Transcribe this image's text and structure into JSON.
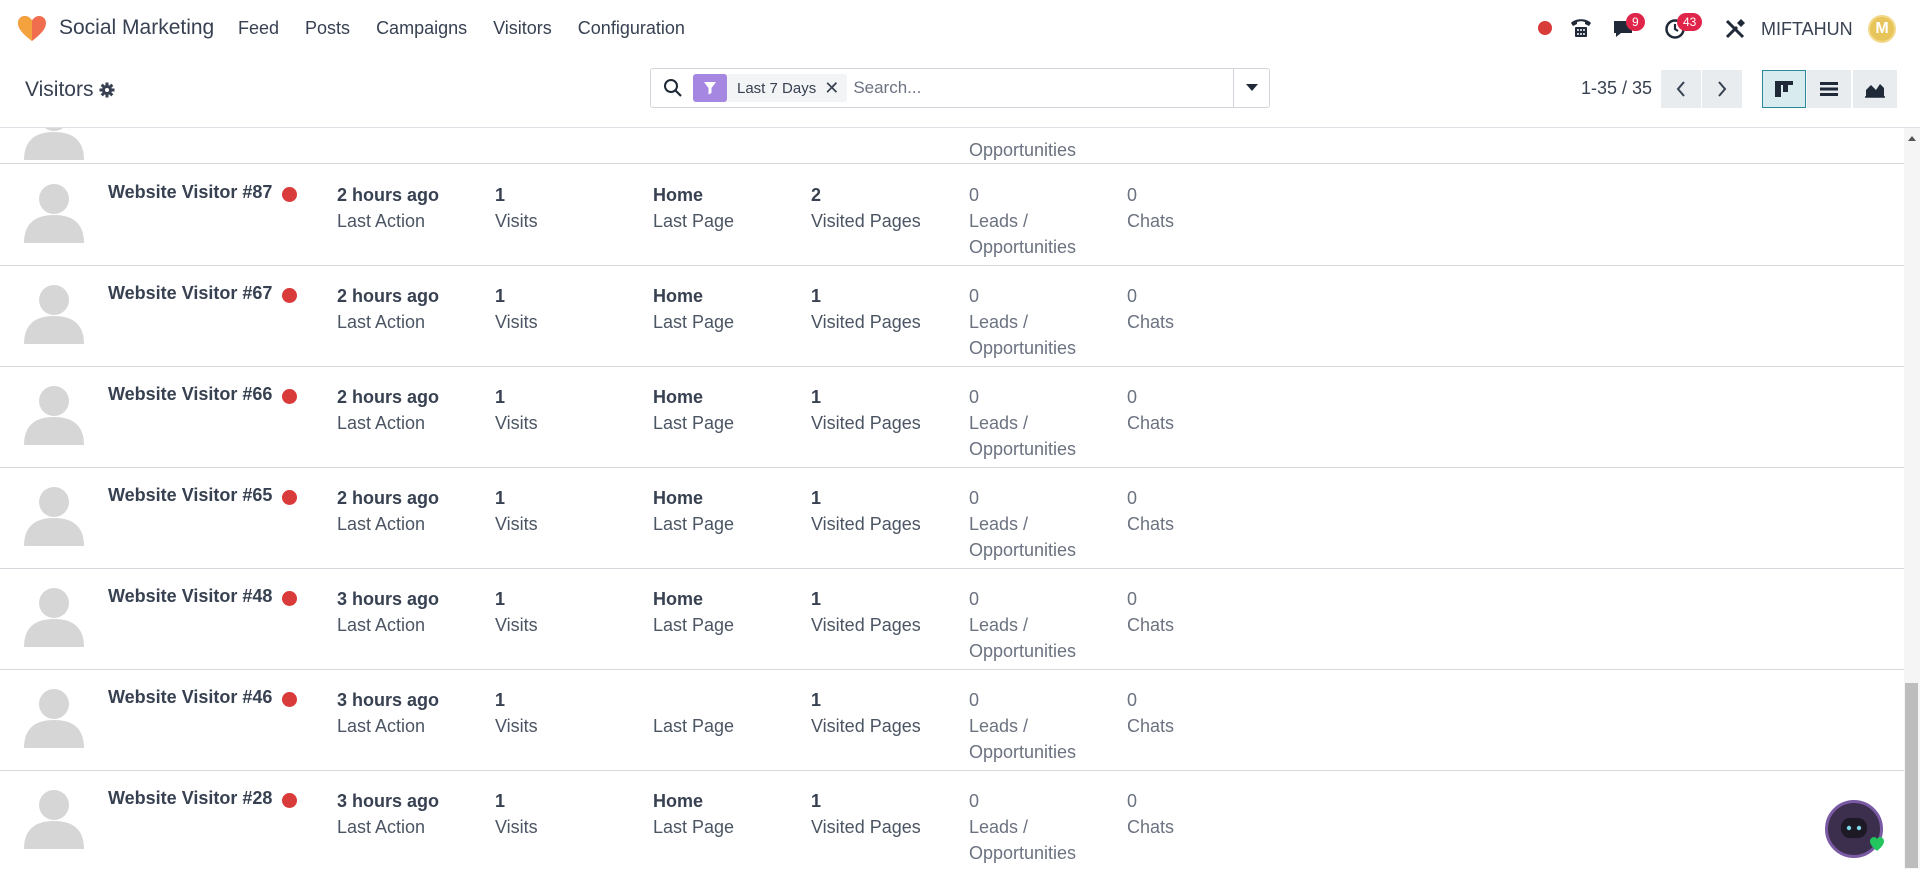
{
  "app": {
    "name": "Social Marketing"
  },
  "menu": [
    "Feed",
    "Posts",
    "Campaigns",
    "Visitors",
    "Configuration"
  ],
  "systray": {
    "messages_count": "9",
    "activities_count": "43",
    "user_name": "MIFTAHUN",
    "user_initial": "M"
  },
  "breadcrumb": {
    "title": "Visitors"
  },
  "search": {
    "facet_label": "Last 7 Days",
    "placeholder": "Search..."
  },
  "pager": {
    "value": "1-35 / 35"
  },
  "labels": {
    "last_action": "Last Action",
    "visits": "Visits",
    "last_page": "Last Page",
    "visited_pages": "Visited Pages",
    "leads_1": "Leads /",
    "leads_2": "Opportunities",
    "chats": "Chats"
  },
  "partial_row": {
    "leads_2": "Opportunities"
  },
  "visitors": [
    {
      "name": "Website Visitor #87",
      "last_action": "2 hours ago",
      "visits": "1",
      "last_page": "Home",
      "visited_pages": "2",
      "leads": "0",
      "chats": "0"
    },
    {
      "name": "Website Visitor #67",
      "last_action": "2 hours ago",
      "visits": "1",
      "last_page": "Home",
      "visited_pages": "1",
      "leads": "0",
      "chats": "0"
    },
    {
      "name": "Website Visitor #66",
      "last_action": "2 hours ago",
      "visits": "1",
      "last_page": "Home",
      "visited_pages": "1",
      "leads": "0",
      "chats": "0"
    },
    {
      "name": "Website Visitor #65",
      "last_action": "2 hours ago",
      "visits": "1",
      "last_page": "Home",
      "visited_pages": "1",
      "leads": "0",
      "chats": "0"
    },
    {
      "name": "Website Visitor #48",
      "last_action": "3 hours ago",
      "visits": "1",
      "last_page": "Home",
      "visited_pages": "1",
      "leads": "0",
      "chats": "0"
    },
    {
      "name": "Website Visitor #46",
      "last_action": "3 hours ago",
      "visits": "1",
      "last_page": "",
      "visited_pages": "1",
      "leads": "0",
      "chats": "0"
    },
    {
      "name": "Website Visitor #28",
      "last_action": "3 hours ago",
      "visits": "1",
      "last_page": "Home",
      "visited_pages": "1",
      "leads": "0",
      "chats": "0"
    }
  ],
  "colors": {
    "online_dot": "#d93a3a",
    "facet": "#a586e0",
    "badge": "#e0254a",
    "active_view": "#2a8a9a"
  },
  "icons": {
    "logo": "social-marketing-logo-icon",
    "gear": "gear-icon",
    "search": "search-icon",
    "filter": "filter-icon",
    "phone": "phone-icon",
    "chat": "chat-icon",
    "clock": "clock-icon",
    "tools": "tools-icon"
  }
}
